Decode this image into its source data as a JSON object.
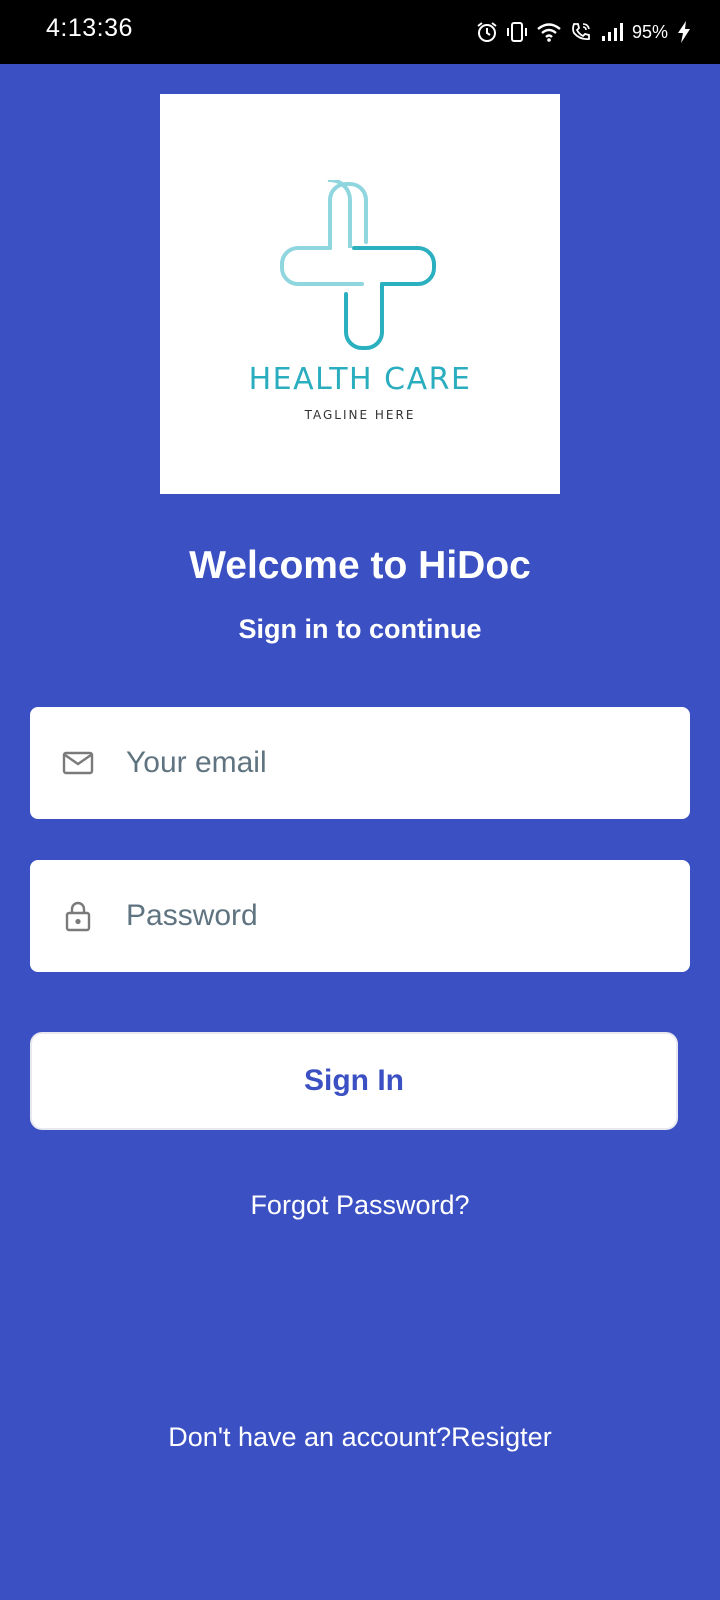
{
  "status_bar": {
    "time": "4:13:36",
    "battery_percent": "95%",
    "icons": [
      "alarm-icon",
      "vibrate-icon",
      "wifi-icon",
      "wifi-calling-icon",
      "signal-icon",
      "battery-charging-icon"
    ]
  },
  "logo": {
    "title": "HEALTH CARE",
    "tagline": "TAGLINE HERE",
    "colors": {
      "light": "#8fd6de",
      "dark": "#2bb0bf"
    }
  },
  "welcome": {
    "title": "Welcome to HiDoc",
    "subtitle": "Sign in to continue"
  },
  "form": {
    "email": {
      "value": "",
      "placeholder": "Your email",
      "icon": "mail-icon"
    },
    "password": {
      "value": "",
      "placeholder": "Password",
      "icon": "lock-icon"
    },
    "signin_label": "Sign In",
    "forgot_label": "Forgot Password?"
  },
  "footer": {
    "prompt": "Don't have an account?",
    "register_label": "Resigter"
  },
  "colors": {
    "background": "#3b50c3",
    "button_text": "#3b50c3",
    "placeholder": "#5f7480"
  }
}
